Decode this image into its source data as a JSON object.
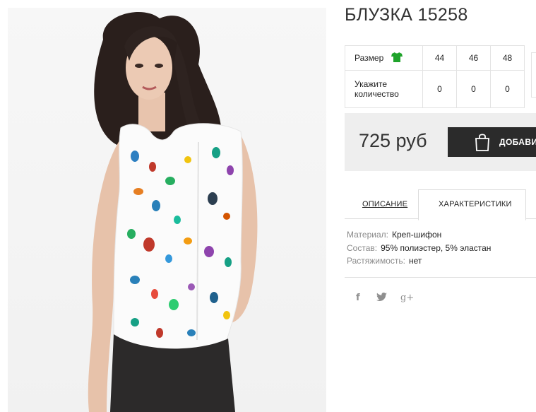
{
  "product": {
    "title": "БЛУЗКА 15258",
    "price": "725 руб"
  },
  "size_table": {
    "size_label": "Размер",
    "quantity_label_line1": "Укажите",
    "quantity_label_line2": "количество",
    "sizes": [
      "44",
      "46",
      "48"
    ],
    "quantities": [
      "0",
      "0",
      "0"
    ],
    "size_icon": "tshirt-icon"
  },
  "cart": {
    "button_label": "ДОБАВИТЬ",
    "icon": "shopping-bag-icon"
  },
  "tabs": [
    {
      "label": "ОПИСАНИЕ",
      "active": false
    },
    {
      "label": "ХАРАКТЕРИСТИКИ",
      "active": true
    }
  ],
  "characteristics": [
    {
      "key": "Материал:",
      "value": "Креп-шифон"
    },
    {
      "key": "Состав:",
      "value": "95% полиэстер, 5% эластан"
    },
    {
      "key": "Растяжимость:",
      "value": "нет"
    }
  ],
  "social": {
    "facebook": "f",
    "twitter": "twitter-icon",
    "googleplus": "g+"
  },
  "colors": {
    "accent_green": "#1fa32b",
    "button_dark": "#2b2b2b",
    "price_band": "#eeeeee"
  }
}
